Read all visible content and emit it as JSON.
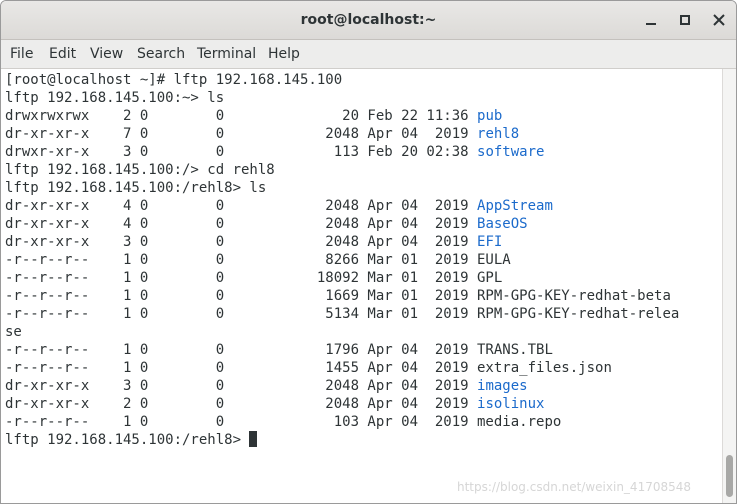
{
  "window": {
    "title": "root@localhost:~"
  },
  "menu": [
    "File",
    "Edit",
    "View",
    "Search",
    "Terminal",
    "Help"
  ],
  "terminal": {
    "lines": [
      [
        {
          "t": "[root@localhost ~]# lftp 192.168.145.100"
        }
      ],
      [
        {
          "t": "lftp 192.168.145.100:~> ls"
        }
      ],
      [
        {
          "t": "drwxrwxrwx    2 0        0              20 Feb 22 11:36 "
        },
        {
          "t": "pub",
          "c": "hl"
        }
      ],
      [
        {
          "t": "dr-xr-xr-x    7 0        0            2048 Apr 04  2019 "
        },
        {
          "t": "rehl8",
          "c": "hl"
        }
      ],
      [
        {
          "t": "drwxr-xr-x    3 0        0             113 Feb 20 02:38 "
        },
        {
          "t": "software",
          "c": "hl"
        }
      ],
      [
        {
          "t": "lftp 192.168.145.100:/> cd rehl8"
        }
      ],
      [
        {
          "t": "lftp 192.168.145.100:/rehl8> ls"
        }
      ],
      [
        {
          "t": "dr-xr-xr-x    4 0        0            2048 Apr 04  2019 "
        },
        {
          "t": "AppStream",
          "c": "hl"
        }
      ],
      [
        {
          "t": "dr-xr-xr-x    4 0        0            2048 Apr 04  2019 "
        },
        {
          "t": "BaseOS",
          "c": "hl"
        }
      ],
      [
        {
          "t": "dr-xr-xr-x    3 0        0            2048 Apr 04  2019 "
        },
        {
          "t": "EFI",
          "c": "hl"
        }
      ],
      [
        {
          "t": "-r--r--r--    1 0        0            8266 Mar 01  2019 EULA"
        }
      ],
      [
        {
          "t": "-r--r--r--    1 0        0           18092 Mar 01  2019 GPL"
        }
      ],
      [
        {
          "t": "-r--r--r--    1 0        0            1669 Mar 01  2019 RPM-GPG-KEY-redhat-beta"
        }
      ],
      [
        {
          "t": "-r--r--r--    1 0        0            5134 Mar 01  2019 RPM-GPG-KEY-redhat-relea"
        }
      ],
      [
        {
          "t": "se"
        }
      ],
      [
        {
          "t": "-r--r--r--    1 0        0            1796 Apr 04  2019 TRANS.TBL"
        }
      ],
      [
        {
          "t": "-r--r--r--    1 0        0            1455 Apr 04  2019 extra_files.json"
        }
      ],
      [
        {
          "t": "dr-xr-xr-x    3 0        0            2048 Apr 04  2019 "
        },
        {
          "t": "images",
          "c": "hl"
        }
      ],
      [
        {
          "t": "dr-xr-xr-x    2 0        0            2048 Apr 04  2019 "
        },
        {
          "t": "isolinux",
          "c": "hl"
        }
      ],
      [
        {
          "t": "-r--r--r--    1 0        0             103 Apr 04  2019 media.repo"
        }
      ],
      [
        {
          "t": "lftp 192.168.145.100:/rehl8> "
        },
        {
          "cursor": true
        }
      ]
    ]
  },
  "colors": {
    "directory": "#1b6acb",
    "text": "#2e3436",
    "background": "#ffffff"
  },
  "icons": {
    "minimize": "minimize-icon",
    "maximize": "maximize-icon",
    "close": "close-icon"
  },
  "watermark": "https://blog.csdn.net/weixin_41708548"
}
